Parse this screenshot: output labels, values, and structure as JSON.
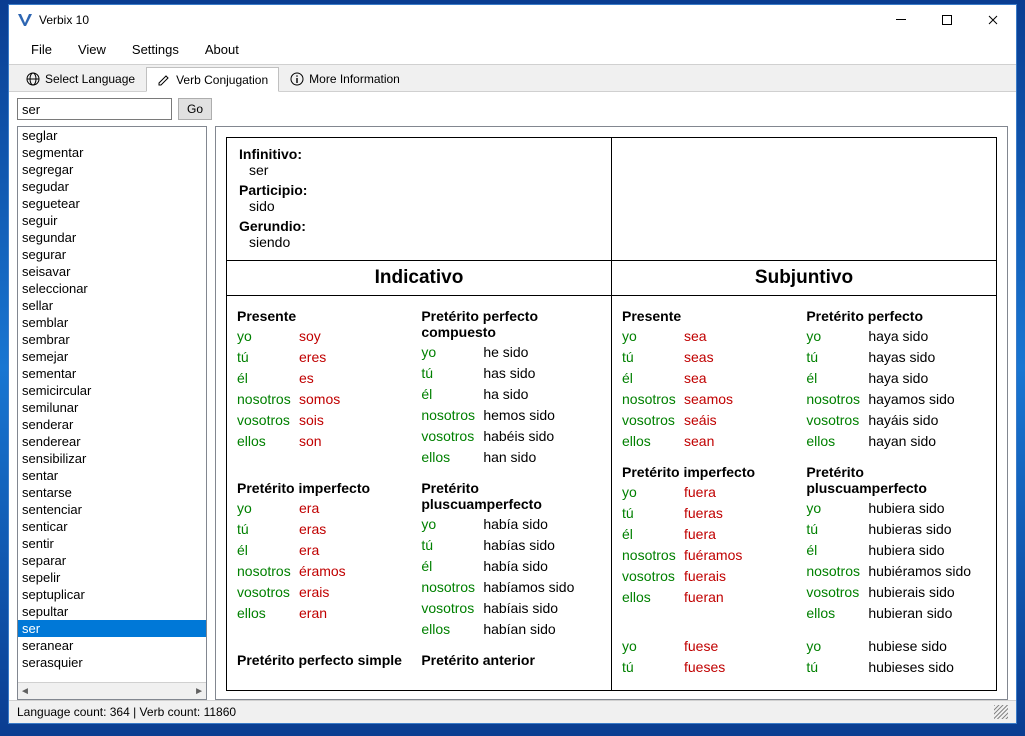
{
  "window": {
    "title": "Verbix 10"
  },
  "menu": {
    "file": "File",
    "view": "View",
    "settings": "Settings",
    "about": "About"
  },
  "tabs": {
    "select_language": "Select Language",
    "verb_conjugation": "Verb Conjugation",
    "more_information": "More Information"
  },
  "search": {
    "value": "ser",
    "go": "Go"
  },
  "sidebar": {
    "items": [
      "seglar",
      "segmentar",
      "segregar",
      "segudar",
      "seguetear",
      "seguir",
      "segundar",
      "segurar",
      "seisavar",
      "seleccionar",
      "sellar",
      "semblar",
      "sembrar",
      "semejar",
      "sementar",
      "semicircular",
      "semilunar",
      "senderar",
      "senderear",
      "sensibilizar",
      "sentar",
      "sentarse",
      "sentenciar",
      "senticar",
      "sentir",
      "separar",
      "sepelir",
      "septuplicar",
      "sepultar",
      "ser",
      "seranear",
      "serasquier"
    ],
    "selected": "ser"
  },
  "header": {
    "infinitivo_label": "Infinitivo:",
    "infinitivo": "ser",
    "participio_label": "Participio:",
    "participio": "sido",
    "gerundio_label": "Gerundio:",
    "gerundio": "siendo"
  },
  "moods": {
    "indicativo": "Indicativo",
    "subjuntivo": "Subjuntivo"
  },
  "pronouns": [
    "yo",
    "tú",
    "él",
    "nosotros",
    "vosotros",
    "ellos"
  ],
  "ind": {
    "presente": {
      "title": "Presente",
      "forms": [
        "soy",
        "eres",
        "es",
        "somos",
        "sois",
        "son"
      ],
      "irregular": true
    },
    "pret_perf_comp": {
      "title": "Pretérito perfecto compuesto",
      "forms": [
        "he sido",
        "has sido",
        "ha sido",
        "hemos sido",
        "habéis sido",
        "han sido"
      ],
      "irregular": false
    },
    "pret_imp": {
      "title": "Pretérito imperfecto",
      "forms": [
        "era",
        "eras",
        "era",
        "éramos",
        "erais",
        "eran"
      ],
      "irregular": true
    },
    "pret_plus": {
      "title": "Pretérito pluscuamperfecto",
      "forms": [
        "había sido",
        "habías sido",
        "había sido",
        "habíamos sido",
        "habíais sido",
        "habían sido"
      ],
      "irregular": false
    },
    "pret_perf_simple_title": "Pretérito perfecto simple",
    "pret_anterior_title": "Pretérito anterior"
  },
  "subj": {
    "presente": {
      "title": "Presente",
      "forms": [
        "sea",
        "seas",
        "sea",
        "seamos",
        "seáis",
        "sean"
      ],
      "irregular": true
    },
    "pret_perf": {
      "title": "Pretérito perfecto",
      "forms": [
        "haya sido",
        "hayas sido",
        "haya sido",
        "hayamos sido",
        "hayáis sido",
        "hayan sido"
      ],
      "irregular": false
    },
    "pret_imp": {
      "title": "Pretérito imperfecto",
      "forms": [
        "fuera",
        "fueras",
        "fuera",
        "fuéramos",
        "fuerais",
        "fueran"
      ],
      "irregular": true
    },
    "pret_plus": {
      "title": "Pretérito pluscuamperfecto",
      "forms": [
        "hubiera sido",
        "hubieras sido",
        "hubiera sido",
        "hubiéramos sido",
        "hubierais sido",
        "hubieran sido"
      ],
      "irregular": false
    },
    "pret_imp2": {
      "forms": [
        "fuese",
        "fueses"
      ],
      "pronouns": [
        "yo",
        "tú"
      ],
      "irregular": true
    },
    "pret_plus2": {
      "forms": [
        "hubiese sido",
        "hubieses sido"
      ],
      "pronouns": [
        "yo",
        "tú"
      ],
      "irregular": false
    }
  },
  "status": {
    "text": "Language count: 364  |  Verb count: 11860"
  }
}
